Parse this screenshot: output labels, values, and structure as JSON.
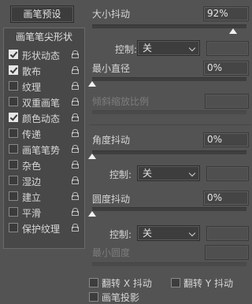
{
  "preset_button": "画笔预设",
  "brush_tip_shape": "画笔笔尖形状",
  "options": [
    {
      "label": "形状动态",
      "checked": true
    },
    {
      "label": "散布",
      "checked": true
    },
    {
      "label": "纹理",
      "checked": false
    },
    {
      "label": "双重画笔",
      "checked": false
    },
    {
      "label": "颜色动态",
      "checked": true
    },
    {
      "label": "传递",
      "checked": false
    },
    {
      "label": "画笔笔势",
      "checked": false
    },
    {
      "label": "杂色",
      "checked": false
    },
    {
      "label": "湿边",
      "checked": false
    },
    {
      "label": "建立",
      "checked": false
    },
    {
      "label": "平滑",
      "checked": false
    },
    {
      "label": "保护纹理",
      "checked": false
    }
  ],
  "size_jitter": {
    "label": "大小抖动",
    "value": "92%",
    "control_label": "控制:",
    "control_value": "关"
  },
  "min_diameter": {
    "label": "最小直径",
    "value": "0%"
  },
  "tilt_scale": {
    "label": "倾斜缩放比例"
  },
  "angle_jitter": {
    "label": "角度抖动",
    "value": "0%",
    "control_label": "控制:",
    "control_value": "关"
  },
  "roundness_jitter": {
    "label": "圆度抖动",
    "value": "0%",
    "control_label": "控制:",
    "control_value": "关"
  },
  "min_roundness": {
    "label": "最小圆度"
  },
  "flip_x": "翻转 X 抖动",
  "flip_y": "翻转 Y 抖动",
  "brush_projection": "画笔投影",
  "colors": {
    "background": "#535353",
    "panel": "#484848",
    "text": "#d6d6d6"
  }
}
